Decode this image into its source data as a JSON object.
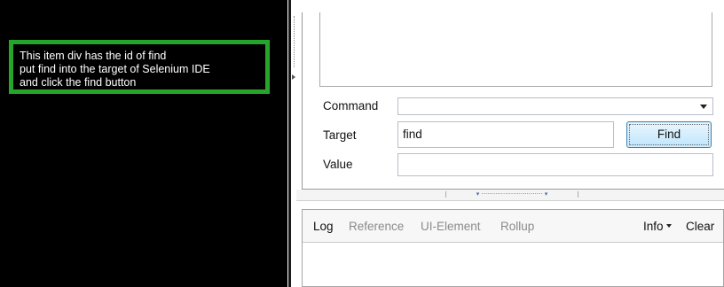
{
  "page": {
    "find_box_lines": [
      "This item div has the id of find",
      "put find into the target of Selenium IDE",
      "and click the find button"
    ]
  },
  "ide": {
    "command_label": "Command",
    "command_value": "",
    "target_label": "Target",
    "target_value": "find",
    "value_label": "Value",
    "value_value": "",
    "find_button_label": "Find"
  },
  "log_panel": {
    "tabs": [
      "Log",
      "Reference",
      "UI-Element",
      "Rollup"
    ],
    "active_tab": "Log",
    "info_label": "Info",
    "clear_label": "Clear"
  },
  "colors": {
    "page_background": "#000000",
    "highlight_border": "#27a52b",
    "button_border": "#3c7fb1"
  },
  "icons": [
    "chevron-down-icon",
    "splitter-arrow-icon",
    "resize-handle-icon"
  ]
}
